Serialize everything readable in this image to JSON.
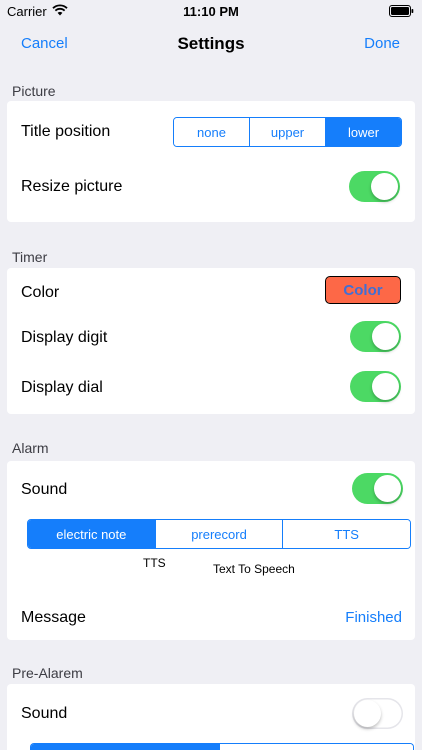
{
  "status_bar": {
    "carrier": "Carrier",
    "time": "11:10 PM"
  },
  "nav": {
    "cancel": "Cancel",
    "title": "Settings",
    "done": "Done"
  },
  "picture": {
    "header": "Picture",
    "title_position_label": "Title position",
    "title_position_options": [
      "none",
      "upper",
      "lower"
    ],
    "title_position_selected": "lower",
    "resize_label": "Resize picture",
    "resize_on": true
  },
  "timer": {
    "header": "Timer",
    "color_label": "Color",
    "color_button": "Color",
    "color_value": "#fd6847",
    "display_digit_label": "Display digit",
    "display_digit_on": true,
    "display_dial_label": "Display dial",
    "display_dial_on": true
  },
  "alarm": {
    "header": "Alarm",
    "sound_label": "Sound",
    "sound_on": true,
    "sound_options": [
      "electric note",
      "prerecord",
      "TTS"
    ],
    "sound_selected": "electric note",
    "tts_label": "TTS",
    "tts_text": "Text To Speech",
    "message_label": "Message",
    "message_value": "Finished"
  },
  "pre_alarm": {
    "header": "Pre-Alarem",
    "sound_label": "Sound",
    "sound_on": false
  },
  "colors": {
    "accent": "#157efb",
    "switch_on": "#4cd964",
    "background": "#efeff4"
  }
}
